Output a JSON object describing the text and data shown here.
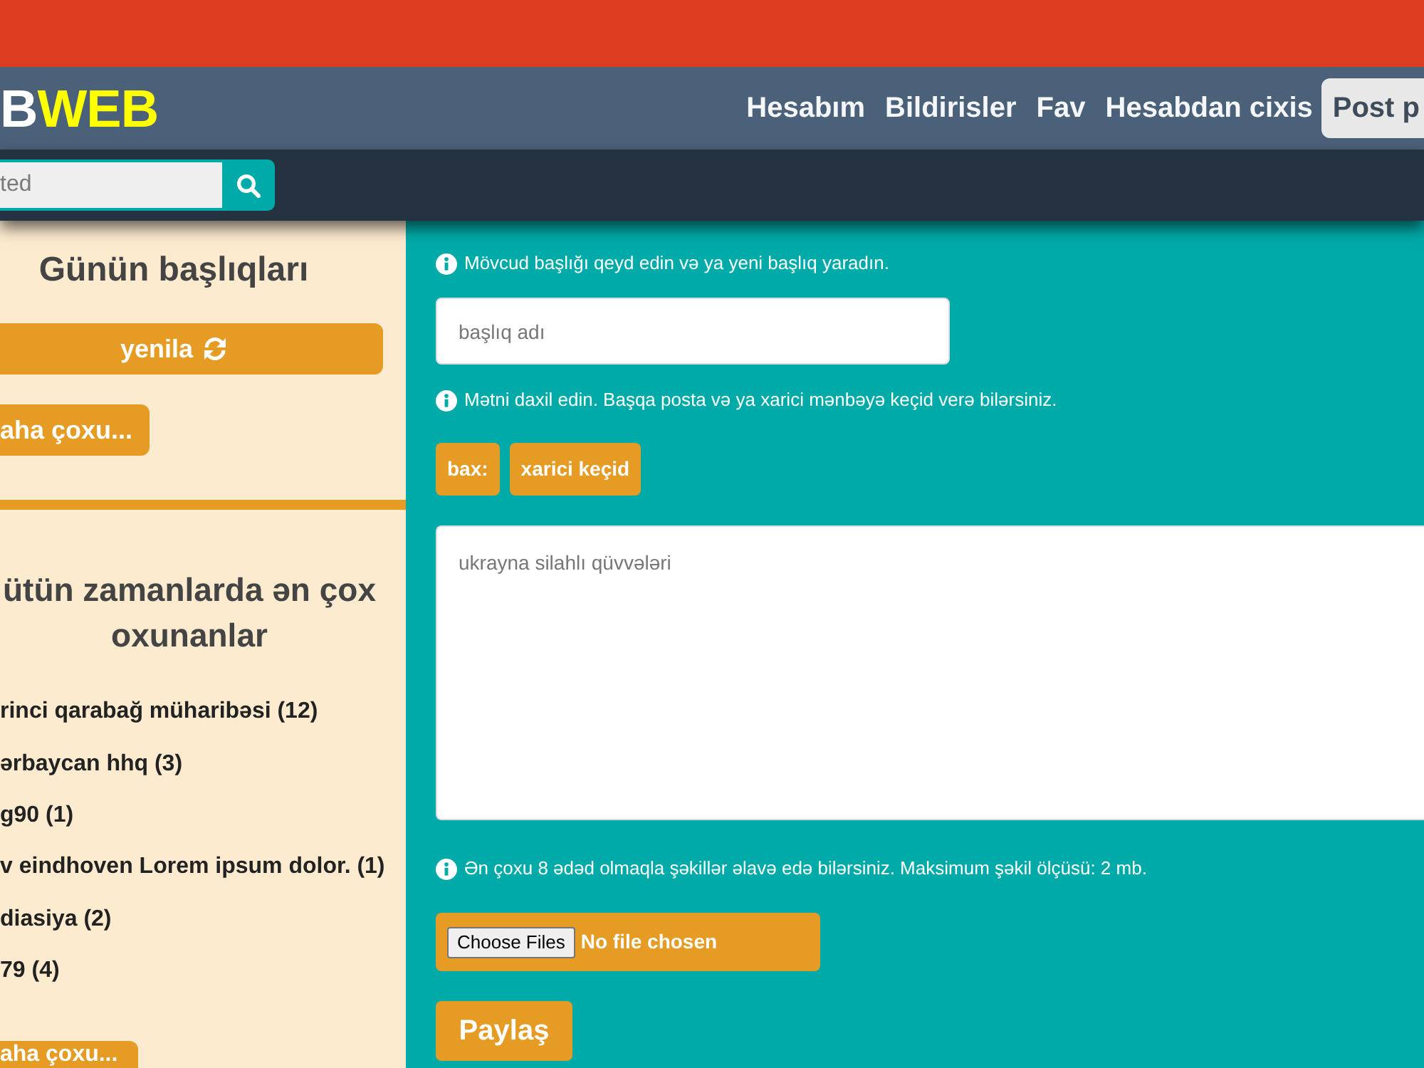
{
  "header": {
    "logo": {
      "part_1": "B",
      "part_2": "WEB"
    },
    "nav_links": [
      "Hesabım",
      "Bildirisler",
      "Fav",
      "Hesabdan cixis"
    ],
    "post_button": "Post p"
  },
  "search": {
    "placeholder": "ted"
  },
  "sidebar": {
    "todays_topics": {
      "title": "Günün başlıqları",
      "refresh_button": "yenila",
      "more_button": "aha çoxu..."
    },
    "most_read": {
      "title": "ütün zamanlarda ən çox oxunanlar",
      "items": [
        "rinci qarabağ müharibəsi (12)",
        "ərbaycan hhq (3)",
        "g90 (1)",
        "v eindhoven Lorem ipsum dolor. (1)",
        "diasiya (2)",
        "79 (4)"
      ],
      "more_button": "aha çoxu..."
    }
  },
  "form": {
    "title_hint": "Mövcud başlığı qeyd edin və ya yeni başlıq yaradın.",
    "title_field": {
      "placeholder": "başlıq adı"
    },
    "text_hint": "Mətni daxil edin. Başqa posta və ya xarici mənbəyə keçid verə bilərsiniz.",
    "link_buttons": [
      "bax:",
      "xarici keçid"
    ],
    "text_area": {
      "placeholder": "ukrayna silahlı qüvvələri"
    },
    "image_hint": "Ən çoxu 8 ədəd olmaqla şəkillər əlavə edə bilərsiniz. Maksimum şəkil ölçüsü: 2 mb.",
    "file_picker": {
      "button": "Choose Files",
      "status": "No file chosen"
    },
    "submit_button": "Paylaş"
  }
}
